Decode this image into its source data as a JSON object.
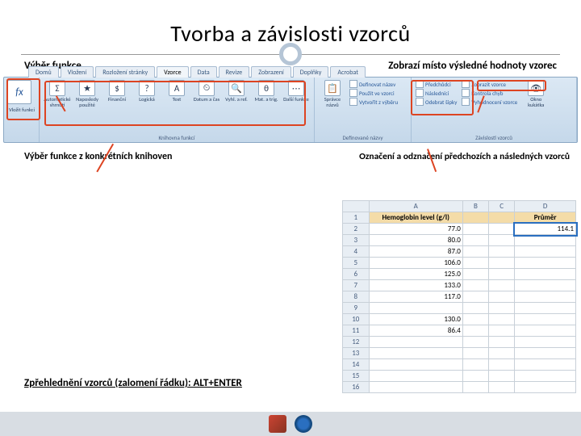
{
  "title": "Tvorba a závislosti vzorců",
  "labels": {
    "top_left": "Výběr funkce",
    "top_right": "Zobrazí místo výsledné hodnoty vzorec",
    "mid_left": "Výběr funkce z konkrétních knihoven",
    "mid_right": "Označení a odznačení předchozích a následných vzorců",
    "bottom": "Zpřehlednění vzorců (zalomení řádku): ALT+ENTER"
  },
  "ribbon": {
    "tabs": [
      "Domů",
      "Vložení",
      "Rozložení stránky",
      "Vzorce",
      "Data",
      "Revize",
      "Zobrazení",
      "Doplňky",
      "Acrobat"
    ],
    "active_tab": 3,
    "fx": "fx",
    "insert_fn": "Vložit funkci",
    "group_lib": "Knihovna funkcí",
    "group_names": "Definované názvy",
    "group_dep": "Závislosti vzorců",
    "buttons_lib": [
      {
        "ic": "Σ",
        "lb": "Automatické shrnutí"
      },
      {
        "ic": "★",
        "lb": "Naposledy použité"
      },
      {
        "ic": "$",
        "lb": "Finanční"
      },
      {
        "ic": "?",
        "lb": "Logická"
      },
      {
        "ic": "A",
        "lb": "Text"
      },
      {
        "ic": "⏲",
        "lb": "Datum a čas"
      },
      {
        "ic": "🔍",
        "lb": "Vyhl. a ref."
      },
      {
        "ic": "θ",
        "lb": "Mat. a trig."
      },
      {
        "ic": "⋯",
        "lb": "Další funkce"
      }
    ],
    "name_mgr": "Správce názvů",
    "names_rows": [
      "Definovat název",
      "Použít ve vzorci",
      "Vytvořit z výběru"
    ],
    "dep_rows_l": [
      "Předchůdci",
      "Následníci",
      "Odebrat šipky"
    ],
    "dep_rows_r": [
      "Zobrazit vzorce",
      "Kontrola chyb",
      "Vyhodnocení vzorce"
    ],
    "watch": "Okno kukátka"
  },
  "sheet": {
    "cols": [
      "",
      "A",
      "B",
      "C",
      "D"
    ],
    "header": [
      "Hemoglobin level (g/l)",
      "",
      "",
      "Průměr"
    ],
    "rows": [
      [
        "2",
        "77.0",
        "",
        "",
        "114.1"
      ],
      [
        "3",
        "80.0",
        "",
        "",
        ""
      ],
      [
        "4",
        "87.0",
        "",
        "",
        ""
      ],
      [
        "5",
        "106.0",
        "",
        "",
        ""
      ],
      [
        "6",
        "125.0",
        "",
        "",
        ""
      ],
      [
        "7",
        "133.0",
        "",
        "",
        ""
      ],
      [
        "8",
        "117.0",
        "",
        "",
        ""
      ],
      [
        "9",
        "",
        "",
        "",
        ""
      ],
      [
        "10",
        "130.0",
        "",
        "",
        ""
      ],
      [
        "11",
        "86.4",
        "",
        "",
        ""
      ],
      [
        "12",
        "",
        "",
        "",
        ""
      ],
      [
        "13",
        "",
        "",
        "",
        ""
      ],
      [
        "14",
        "",
        "",
        "",
        ""
      ],
      [
        "15",
        "",
        "",
        "",
        ""
      ],
      [
        "16",
        "",
        "",
        "",
        ""
      ]
    ]
  }
}
